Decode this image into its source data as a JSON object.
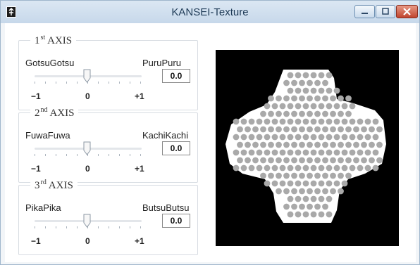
{
  "window": {
    "title": "KANSEI-Texture"
  },
  "axes": [
    {
      "number": "1",
      "suffix": "st",
      "title": "AXIS",
      "left_label": "GotsuGotsu",
      "right_label": "PuruPuru",
      "value": "0.0",
      "scale": [
        "−1",
        "0",
        "+1"
      ]
    },
    {
      "number": "2",
      "suffix": "nd",
      "title": "AXIS",
      "left_label": "FuwaFuwa",
      "right_label": "KachiKachi",
      "value": "0.0",
      "scale": [
        "−1",
        "0",
        "+1"
      ]
    },
    {
      "number": "3",
      "suffix": "rd",
      "title": "AXIS",
      "left_label": "PikaPika",
      "right_label": "ButsuButsu",
      "value": "0.0",
      "scale": [
        "−1",
        "0",
        "+1"
      ]
    }
  ],
  "icons": {
    "app": "app-icon",
    "minimize": "minimize-icon",
    "maximize": "maximize-icon",
    "close": "close-icon"
  },
  "colors": {
    "preview_bg": "#000000",
    "texture_light": "#ffffff",
    "texture_dots": "#a9a9a9"
  }
}
